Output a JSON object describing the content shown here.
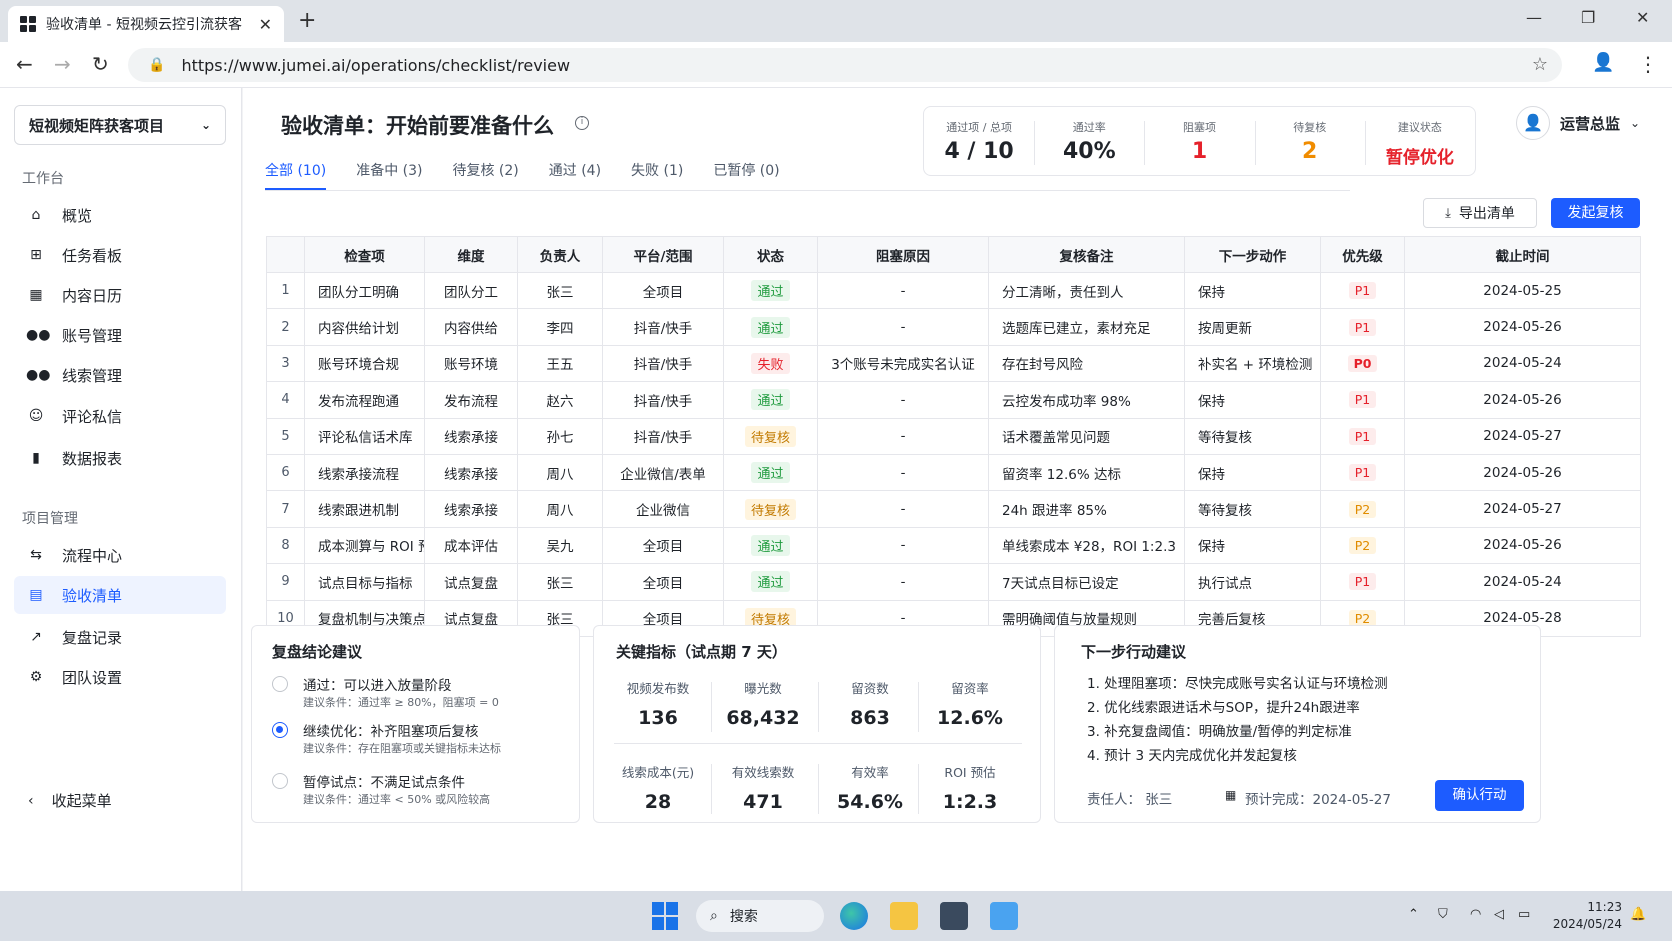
{
  "browser": {
    "tab_title": "验收清单 - 短视频云控引流获客",
    "url": "https://www.jumei.ai/operations/checklist/review"
  },
  "sidebar": {
    "project": "短视频矩阵获客项目",
    "section1": "工作台",
    "section2": "项目管理",
    "items": [
      {
        "label": "概览",
        "icon": "home-icon"
      },
      {
        "label": "任务看板",
        "icon": "task-board-icon"
      },
      {
        "label": "内容日历",
        "icon": "calendar-icon"
      },
      {
        "label": "账号管理",
        "icon": "users-icon"
      },
      {
        "label": "线索管理",
        "icon": "leads-icon"
      },
      {
        "label": "评论私信",
        "icon": "chat-icon"
      },
      {
        "label": "数据报表",
        "icon": "bar-chart-icon"
      },
      {
        "label": "流程中心",
        "icon": "flow-icon"
      },
      {
        "label": "验收清单",
        "icon": "checklist-icon"
      },
      {
        "label": "复盘记录",
        "icon": "trend-icon"
      },
      {
        "label": "团队设置",
        "icon": "gear-icon"
      }
    ],
    "collapse": "收起菜单"
  },
  "header": {
    "title": "验收清单：开始前要准备什么",
    "user": "运营总监"
  },
  "stats": [
    {
      "label": "通过项 / 总项",
      "value": "4 / 10",
      "color": "#1f2329"
    },
    {
      "label": "通过率",
      "value": "40%",
      "color": "#1f2329"
    },
    {
      "label": "阻塞项",
      "value": "1",
      "color": "#e5212b"
    },
    {
      "label": "待复核",
      "value": "2",
      "color": "#f08c00"
    },
    {
      "label": "建议状态",
      "value": "暂停优化",
      "color": "#e5212b"
    }
  ],
  "filter_tabs": [
    "全部 (10)",
    "准备中 (3)",
    "待复核 (2)",
    "通过 (4)",
    "失败 (1)",
    "已暂停 (0)"
  ],
  "actions": {
    "export": "导出清单",
    "review": "发起复核"
  },
  "table": {
    "headers": [
      "",
      "检查项",
      "维度",
      "负责人",
      "平台/范围",
      "状态",
      "阻塞原因",
      "复核备注",
      "下一步动作",
      "优先级",
      "截止时间"
    ],
    "rows": [
      [
        "1",
        "团队分工明确",
        "团队分工",
        "张三",
        "全项目",
        "通过",
        "-",
        "分工清晰，责任到人",
        "保持",
        "P1",
        "2024-05-25"
      ],
      [
        "2",
        "内容供给计划",
        "内容供给",
        "李四",
        "抖音/快手",
        "通过",
        "-",
        "选题库已建立，素材充足",
        "按周更新",
        "P1",
        "2024-05-26"
      ],
      [
        "3",
        "账号环境合规",
        "账号环境",
        "王五",
        "抖音/快手",
        "失败",
        "3个账号未完成实名认证",
        "存在封号风险",
        "补实名 + 环境检测",
        "P0",
        "2024-05-24"
      ],
      [
        "4",
        "发布流程跑通",
        "发布流程",
        "赵六",
        "抖音/快手",
        "通过",
        "-",
        "云控发布成功率 98%",
        "保持",
        "P1",
        "2024-05-26"
      ],
      [
        "5",
        "评论私信话术库",
        "线索承接",
        "孙七",
        "抖音/快手",
        "待复核",
        "-",
        "话术覆盖常见问题",
        "等待复核",
        "P1",
        "2024-05-27"
      ],
      [
        "6",
        "线索承接流程",
        "线索承接",
        "周八",
        "企业微信/表单",
        "通过",
        "-",
        "留资率 12.6% 达标",
        "保持",
        "P1",
        "2024-05-26"
      ],
      [
        "7",
        "线索跟进机制",
        "线索承接",
        "周八",
        "企业微信",
        "待复核",
        "-",
        "24h 跟进率 85%",
        "等待复核",
        "P2",
        "2024-05-27"
      ],
      [
        "8",
        "成本测算与 ROI 预期",
        "成本评估",
        "吴九",
        "全项目",
        "通过",
        "-",
        "单线索成本 ¥28，ROI 1:2.3",
        "保持",
        "P2",
        "2024-05-26"
      ],
      [
        "9",
        "试点目标与指标",
        "试点复盘",
        "张三",
        "全项目",
        "通过",
        "-",
        "7天试点目标已设定",
        "执行试点",
        "P1",
        "2024-05-24"
      ],
      [
        "10",
        "复盘机制与决策点",
        "试点复盘",
        "张三",
        "全项目",
        "待复核",
        "-",
        "需明确阈值与放量规则",
        "完善后复核",
        "P2",
        "2024-05-28"
      ]
    ]
  },
  "conclusion": {
    "title": "复盘结论建议",
    "options": [
      {
        "title": "通过：可以进入放量阶段",
        "sub": "建议条件：通过率 ≥ 80%，阻塞项 = 0",
        "selected": false
      },
      {
        "title": "继续优化：补齐阻塞项后复核",
        "sub": "建议条件：存在阻塞项或关键指标未达标",
        "selected": true
      },
      {
        "title": "暂停试点：不满足试点条件",
        "sub": "建议条件：通过率 < 50% 或风险较高",
        "selected": false
      }
    ]
  },
  "metrics": {
    "title": "关键指标（试点期 7 天）",
    "items": [
      {
        "label": "视频发布数",
        "value": "136"
      },
      {
        "label": "曝光数",
        "value": "68,432"
      },
      {
        "label": "留资数",
        "value": "863"
      },
      {
        "label": "留资率",
        "value": "12.6%"
      },
      {
        "label": "线索成本(元)",
        "value": "28"
      },
      {
        "label": "有效线索数",
        "value": "471"
      },
      {
        "label": "有效率",
        "value": "54.6%"
      },
      {
        "label": "ROI 预估",
        "value": "1:2.3"
      }
    ]
  },
  "next_steps": {
    "title": "下一步行动建议",
    "steps": [
      "1.  处理阻塞项：尽快完成账号实名认证与环境检测",
      "2.  优化线索跟进话术与SOP，提升24h跟进率",
      "3.  补充复盘阈值：明确放量/暂停的判定标准",
      "4.  预计 3 天内完成优化并发起复核"
    ],
    "owner": "责任人：   张三",
    "eta": "预计完成：2024-05-27",
    "confirm": "确认行动"
  },
  "taskbar": {
    "search": "搜索",
    "time": "11:23",
    "date": "2024/05/24"
  }
}
